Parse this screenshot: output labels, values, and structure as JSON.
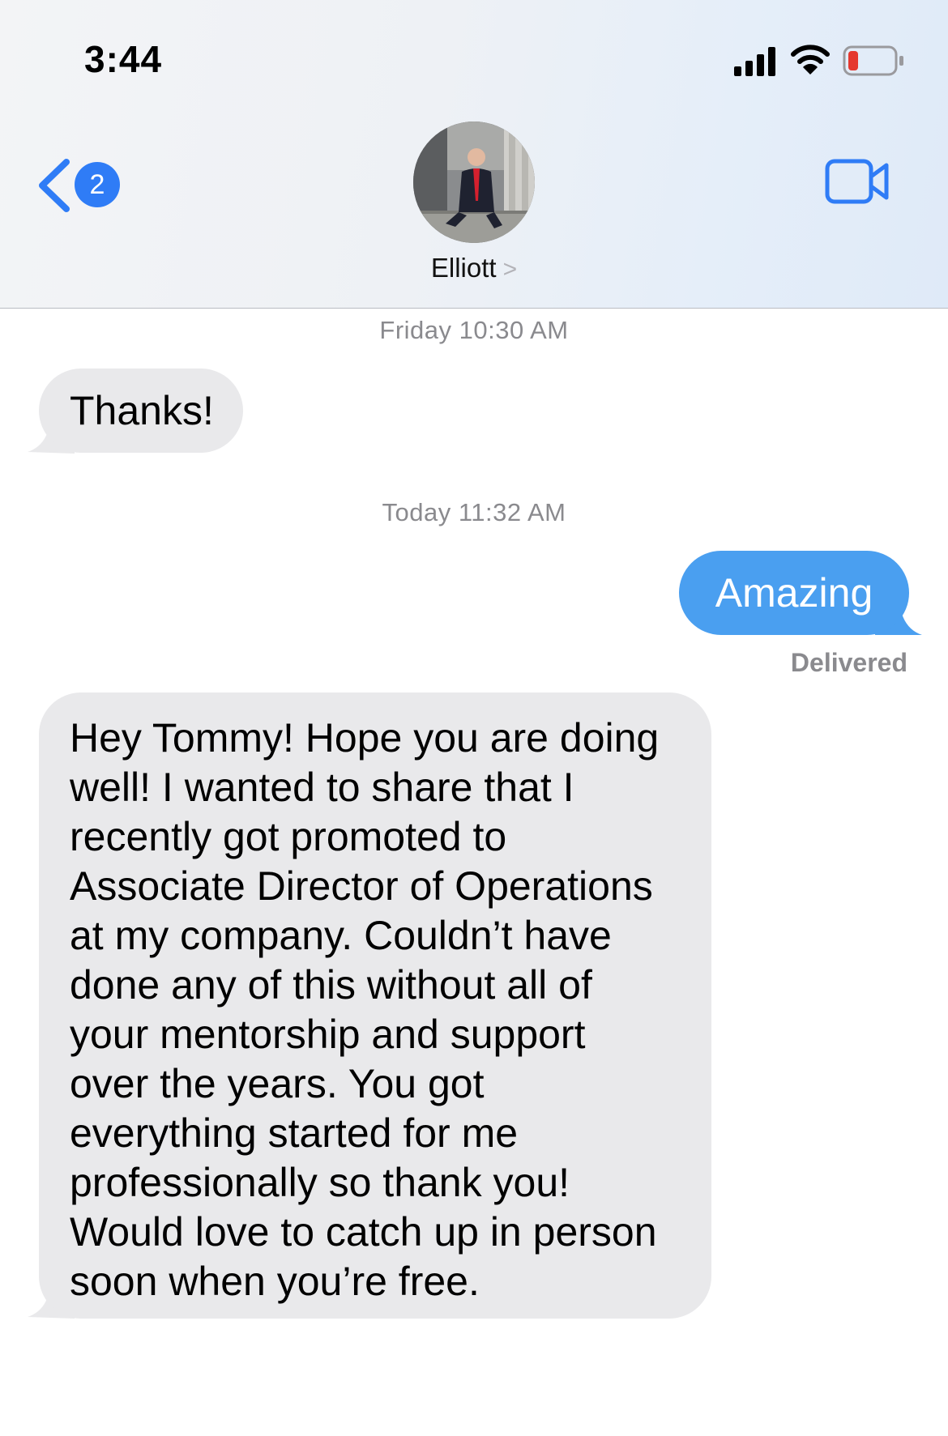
{
  "status_bar": {
    "time": "3:44"
  },
  "nav": {
    "back_badge": "2",
    "contact_name": "Elliott",
    "contact_chevron": ">"
  },
  "messages": [
    {
      "type": "timestamp",
      "text": "Friday 10:30 AM"
    },
    {
      "type": "incoming",
      "text": "Thanks!"
    },
    {
      "type": "timestamp",
      "text": "Today 11:32 AM"
    },
    {
      "type": "outgoing",
      "text": "Amazing",
      "status": "Delivered"
    },
    {
      "type": "incoming",
      "text": "Hey Tommy! Hope you are doing\nwell! I wanted to share that I\nrecently got promoted to\nAssociate Director of Operations\nat my company. Couldn’t have\ndone any of this without all of\nyour mentorship and support\nover the years. You got\neverything started for me\nprofessionally so thank you!\nWould love to catch up in person\nsoon when you’re free."
    }
  ],
  "colors": {
    "accent_blue": "#2f7cf6",
    "outgoing_bubble": "#4a9ff0",
    "incoming_bubble": "#e9e9eb",
    "battery_low": "#e5382f"
  },
  "icons": [
    "signal-icon",
    "wifi-icon",
    "battery-icon",
    "back-chevron-icon",
    "video-call-icon",
    "chevron-right-icon"
  ]
}
